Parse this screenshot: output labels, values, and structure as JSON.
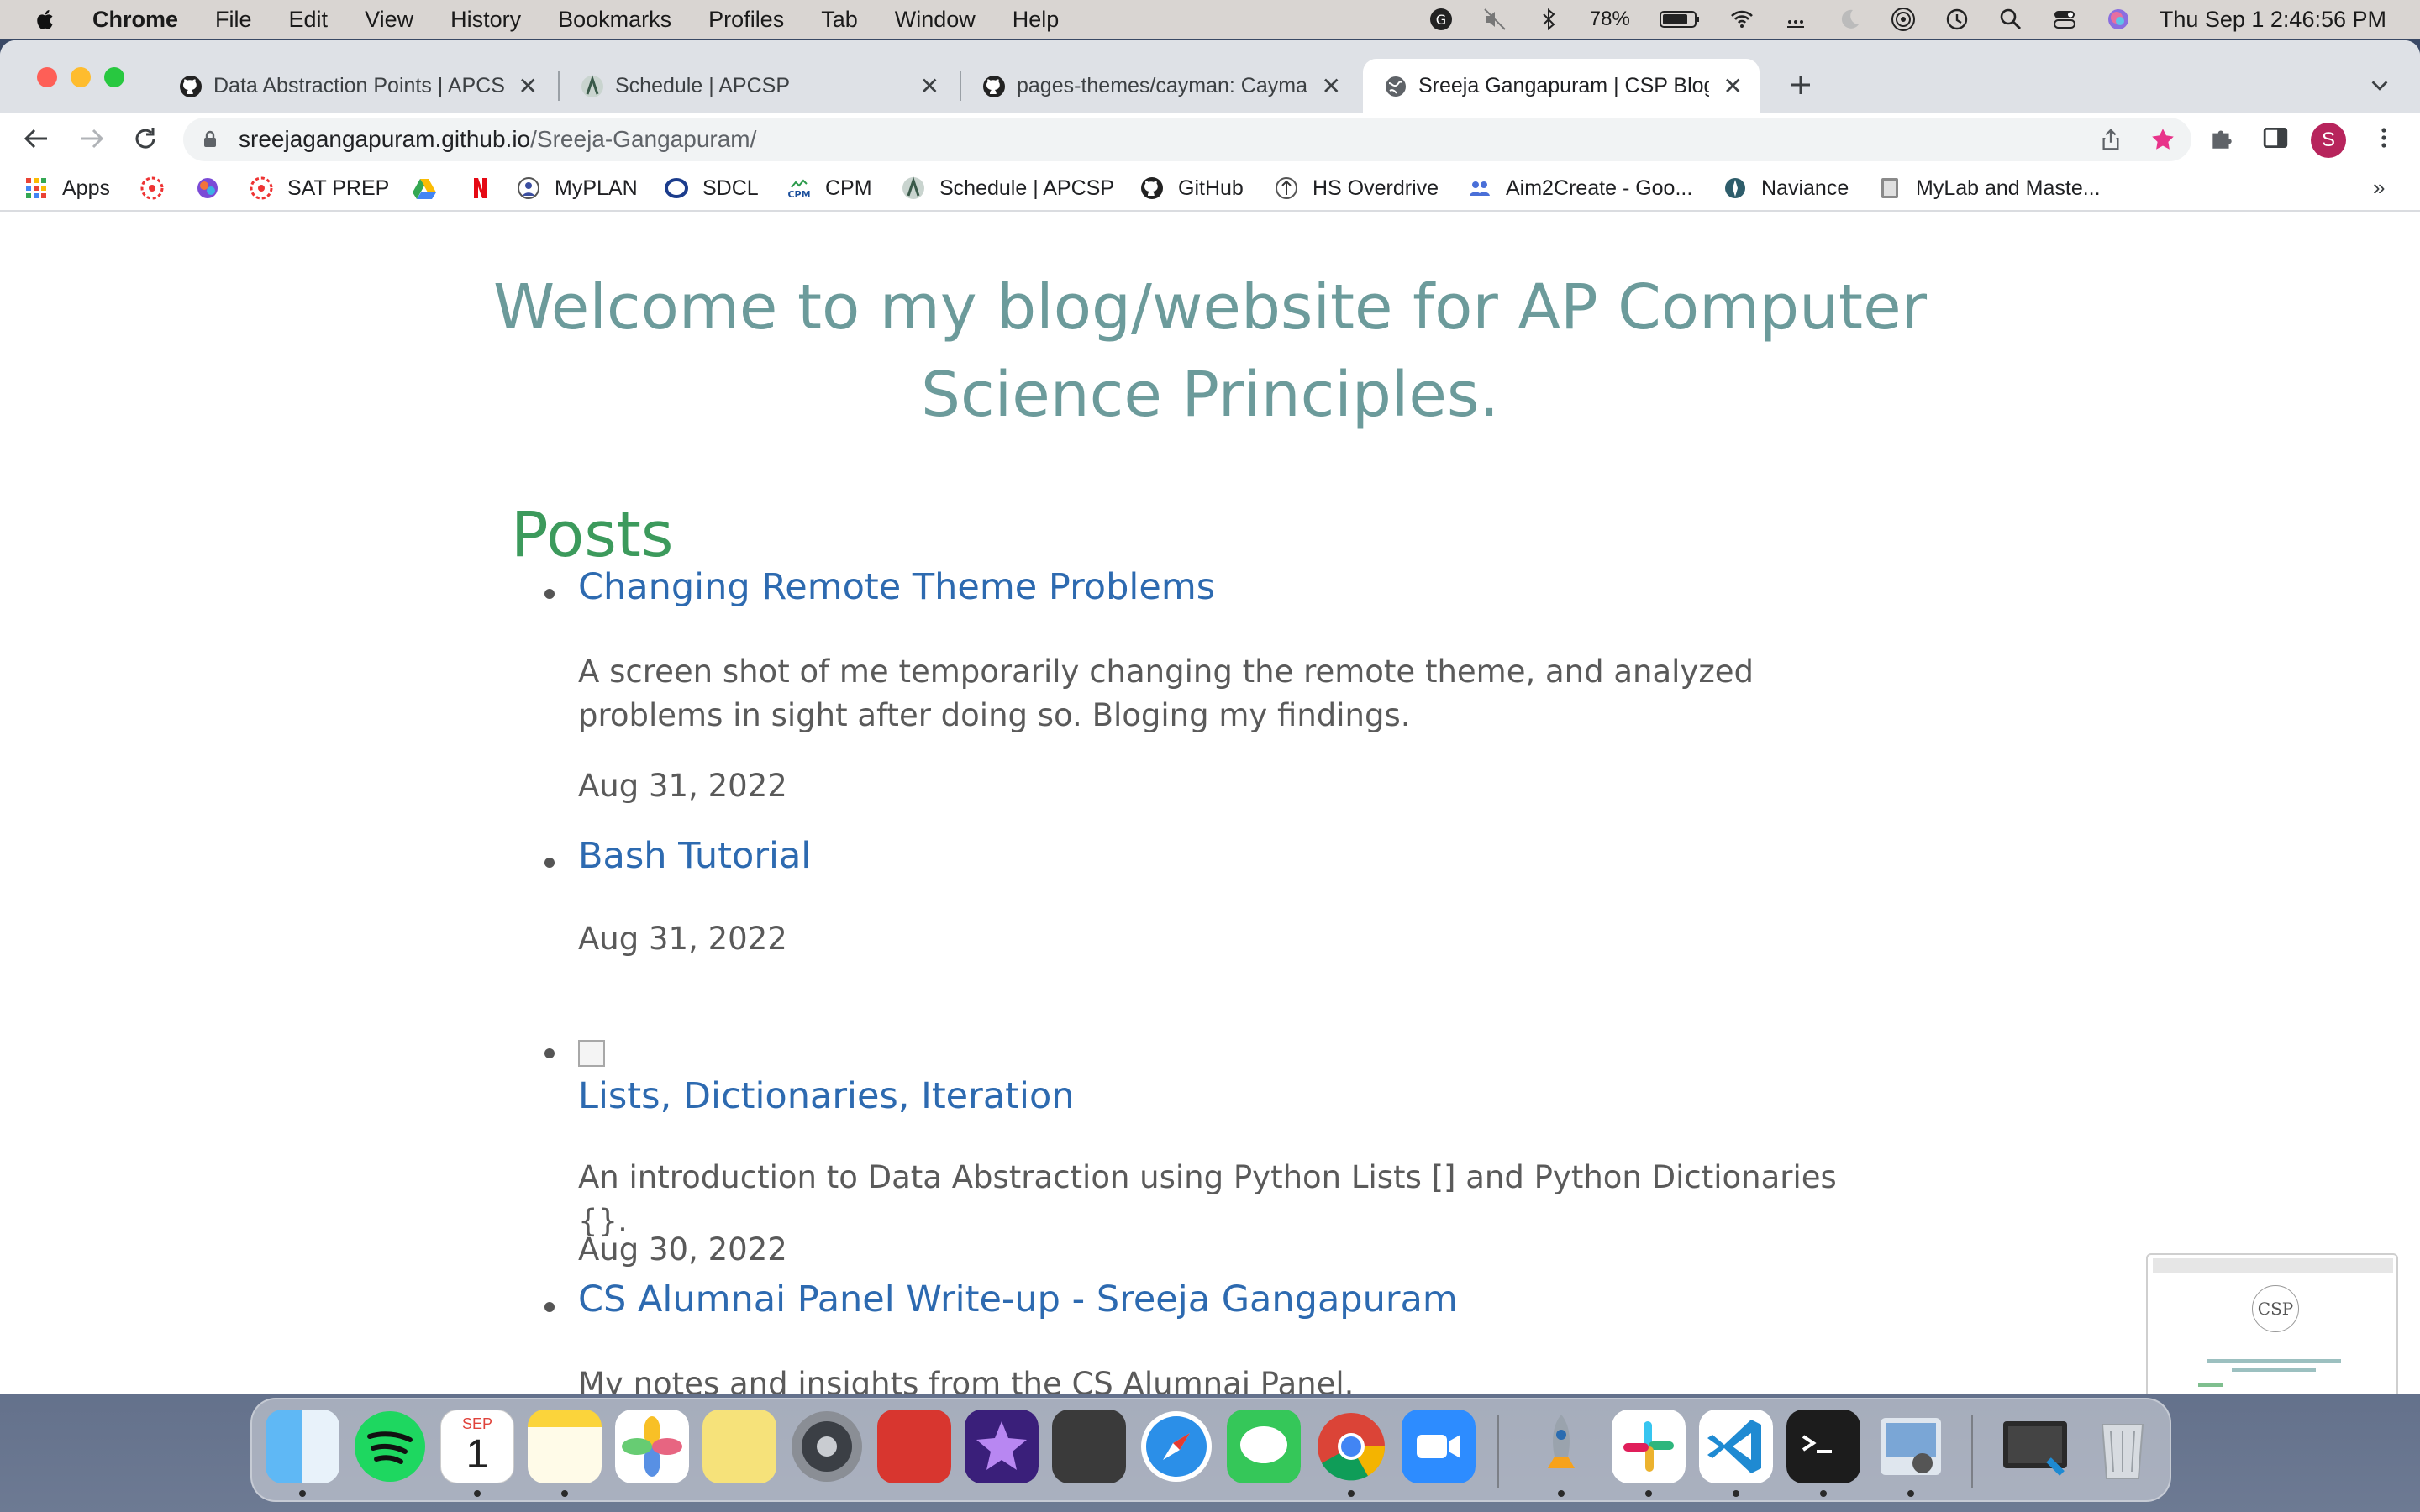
{
  "menubar": {
    "app_name": "Chrome",
    "items": [
      "File",
      "Edit",
      "View",
      "History",
      "Bookmarks",
      "Profiles",
      "Tab",
      "Window",
      "Help"
    ],
    "battery": "78%",
    "datetime": "Thu Sep 1  2:46:56 PM"
  },
  "tabs": [
    {
      "label": "Data Abstraction Points | APCSP",
      "icon": "github-icon",
      "active": false
    },
    {
      "label": "Schedule | APCSP",
      "icon": "apcsp-icon",
      "active": false
    },
    {
      "label": "pages-themes/cayman: Cayman",
      "icon": "github-icon",
      "active": false
    },
    {
      "label": "Sreeja Gangapuram | CSP Blog",
      "icon": "globe-icon",
      "active": true
    }
  ],
  "address": {
    "host": "sreejagangapuram.github.io",
    "path": "/Sreeja-Gangapuram/"
  },
  "profile_initial": "S",
  "bookmarks": [
    {
      "label": "Apps",
      "icon": "apps-grid-icon"
    },
    {
      "label": "",
      "icon": "canvas-icon"
    },
    {
      "label": "",
      "icon": "pinwheel-icon"
    },
    {
      "label": "SAT PREP",
      "icon": "canvas-icon"
    },
    {
      "label": "",
      "icon": "google-drive-icon"
    },
    {
      "label": "",
      "icon": "netflix-icon"
    },
    {
      "label": "MyPLAN",
      "icon": "myplan-icon"
    },
    {
      "label": "SDCL",
      "icon": "sdcl-icon"
    },
    {
      "label": "CPM",
      "icon": "cpm-icon"
    },
    {
      "label": "Schedule | APCSP",
      "icon": "apcsp-icon"
    },
    {
      "label": "GitHub",
      "icon": "github-icon"
    },
    {
      "label": "HS Overdrive",
      "icon": "overdrive-icon"
    },
    {
      "label": "Aim2Create - Goo...",
      "icon": "people-icon"
    },
    {
      "label": "Naviance",
      "icon": "naviance-icon"
    },
    {
      "label": "MyLab and Maste...",
      "icon": "mylab-icon"
    }
  ],
  "page": {
    "welcome": "Welcome to my blog/website for AP Computer Science Principles.",
    "posts_heading": "Posts",
    "posts": [
      {
        "title": "Changing Remote Theme Problems",
        "description": "A screen shot of me temporarily changing the remote theme, and analyzed problems in sight after doing so. Bloging my findings.",
        "date": "Aug 31, 2022"
      },
      {
        "title": "Bash Tutorial",
        "description": "",
        "date": "Aug 31, 2022"
      },
      {
        "title": "Lists, Dictionaries, Iteration",
        "description": "An introduction to Data Abstraction using Python Lists [] and Python Dictionaries {}.",
        "date": "Aug 30, 2022",
        "has_image": true
      },
      {
        "title": "CS Alumnai Panel Write-up - Sreeja Gangapuram",
        "description": "My notes and insights from the CS Alumnai Panel.",
        "date": ""
      }
    ]
  },
  "thumbnail": {
    "logo_text": "CSP"
  },
  "dock": {
    "calendar_month": "SEP",
    "calendar_day": "1",
    "apps": [
      "finder-icon",
      "spotify-icon",
      "calendar-icon",
      "notes-icon",
      "photos-icon",
      "stickies-icon",
      "system-preferences-icon",
      "photo-booth-icon",
      "imovie-icon",
      "calculator-icon",
      "safari-icon",
      "messages-icon",
      "chrome-icon",
      "zoom-icon",
      "launchpad-icon",
      "slack-icon",
      "vscode-icon",
      "terminal-icon",
      "preview-icon",
      "screenshot-icon",
      "trash-icon"
    ]
  }
}
